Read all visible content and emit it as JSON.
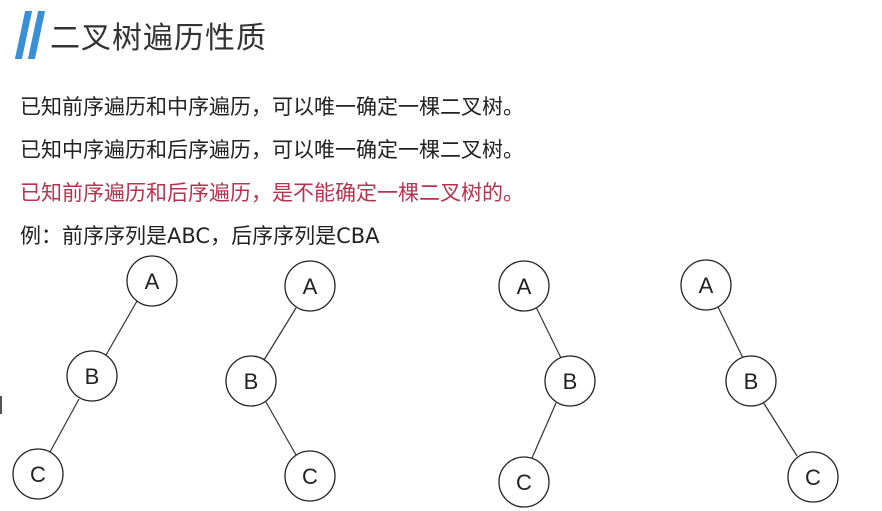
{
  "slide": {
    "title": "二叉树遍历性质",
    "accent_color": "#3a8fd6",
    "lines": [
      {
        "text": "已知前序遍历和中序遍历，可以唯一确定一棵二叉树。"
      },
      {
        "text": "已知中序遍历和后序遍历，可以唯一确定一棵二叉树。"
      },
      {
        "text": "已知前序遍历和后序遍历，是不能确定一棵二叉树的。",
        "color": "#b5334e"
      },
      {
        "text": "例：前序序列是ABC，后序序列是CBA"
      }
    ]
  },
  "trees": [
    {
      "nodes": [
        "A",
        "B",
        "C"
      ],
      "shape": "left-left"
    },
    {
      "nodes": [
        "A",
        "B",
        "C"
      ],
      "shape": "left-right"
    },
    {
      "nodes": [
        "A",
        "B",
        "C"
      ],
      "shape": "right-left"
    },
    {
      "nodes": [
        "A",
        "B",
        "C"
      ],
      "shape": "right-right"
    }
  ]
}
